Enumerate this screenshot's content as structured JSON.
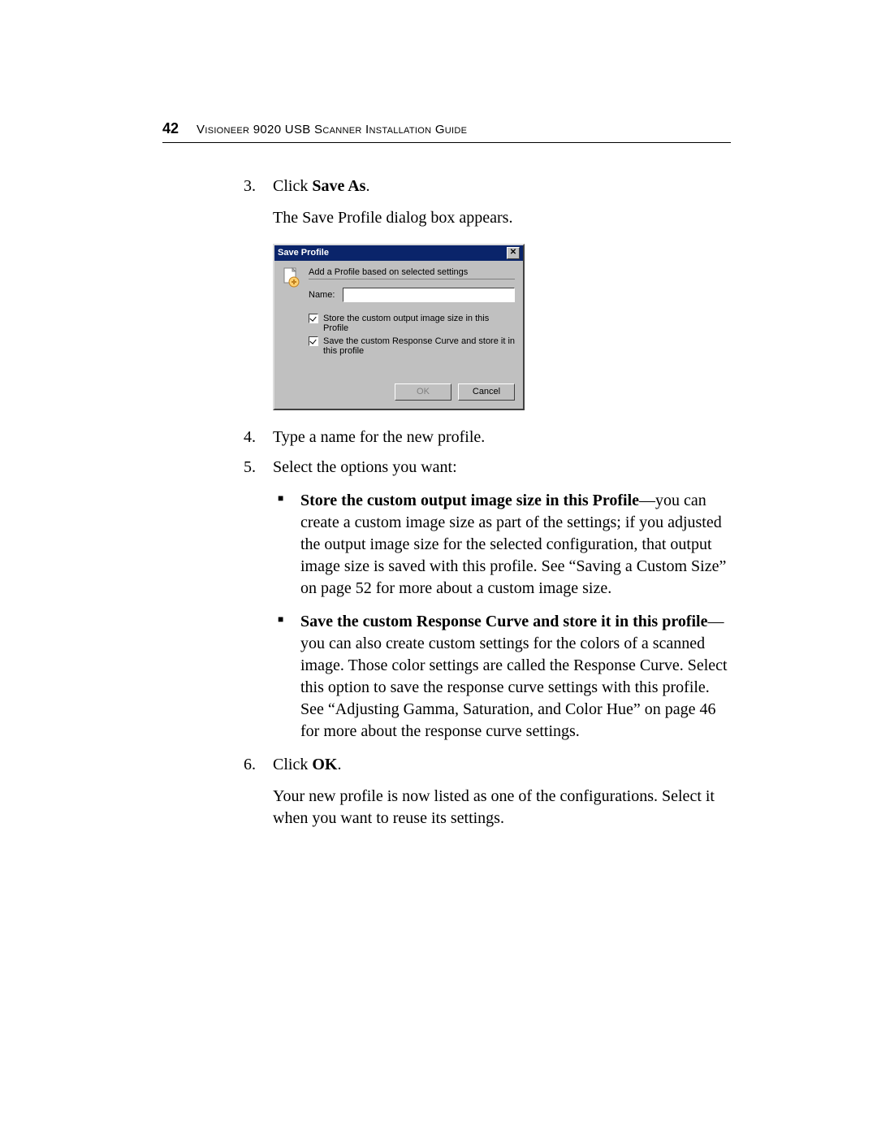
{
  "header": {
    "page_number": "42",
    "title": "Visioneer 9020 USB Scanner Installation Guide"
  },
  "steps": {
    "s3": {
      "num": "3.",
      "text_prefix": "Click ",
      "text_bold": "Save As",
      "text_suffix": ".",
      "after": "The Save Profile dialog box appears."
    },
    "s4": {
      "num": "4.",
      "text": "Type a name for the new profile."
    },
    "s5": {
      "num": "5.",
      "text": "Select the options you want:"
    },
    "s6": {
      "num": "6.",
      "text_prefix": "Click ",
      "text_bold": "OK",
      "text_suffix": ".",
      "after": "Your new profile is now listed as one of the configurations. Select it when you want to reuse its settings."
    }
  },
  "bullets": {
    "b1": {
      "bold": "Store the custom output image size in this Profile",
      "rest": "—you can create a custom image size as part of the settings; if you adjusted the output image size for the selected configuration, that output image size is saved with this profile. See “Saving a Custom Size” on page 52 for more about a custom image size."
    },
    "b2": {
      "bold": "Save the custom Response Curve and store it in this profile",
      "rest": "—you can also create custom settings for the colors of a scanned image. Those color settings are called the Response Curve. Select this option to save the response curve settings with this profile. See “Adjusting Gamma, Saturation, and Color Hue” on page 46 for more about the response curve settings."
    }
  },
  "dialog": {
    "title": "Save Profile",
    "close": "✕",
    "heading": "Add a Profile based on selected settings",
    "name_label": "Name:",
    "name_value": "",
    "check1": "Store the custom output image size in this Profile",
    "check2": "Save the custom Response Curve and store it in this profile",
    "ok": "OK",
    "cancel": "Cancel"
  }
}
